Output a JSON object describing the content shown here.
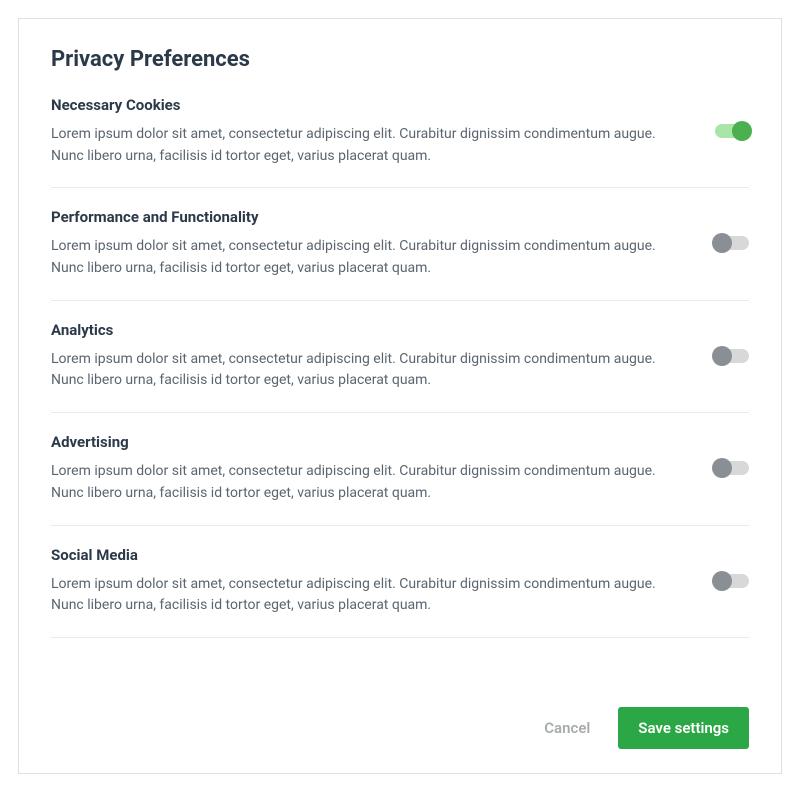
{
  "title": "Privacy Preferences",
  "categories": [
    {
      "title": "Necessary Cookies",
      "desc": "Lorem ipsum dolor sit amet, consectetur adipiscing elit. Curabitur dignissim condimentum augue. Nunc libero urna, facilisis id tortor eget, varius placerat quam.",
      "on": true
    },
    {
      "title": "Performance and Functionality",
      "desc": "Lorem ipsum dolor sit amet, consectetur adipiscing elit. Curabitur dignissim condimentum augue. Nunc libero urna, facilisis id tortor eget, varius placerat quam.",
      "on": false
    },
    {
      "title": "Analytics",
      "desc": "Lorem ipsum dolor sit amet, consectetur adipiscing elit. Curabitur dignissim condimentum augue. Nunc libero urna, facilisis id tortor eget, varius placerat quam.",
      "on": false
    },
    {
      "title": "Advertising",
      "desc": "Lorem ipsum dolor sit amet, consectetur adipiscing elit. Curabitur dignissim condimentum augue. Nunc libero urna, facilisis id tortor eget, varius placerat quam.",
      "on": false
    },
    {
      "title": "Social Media",
      "desc": "Lorem ipsum dolor sit amet, consectetur adipiscing elit. Curabitur dignissim condimentum augue. Nunc libero urna, facilisis id tortor eget, varius placerat quam.",
      "on": false
    }
  ],
  "actions": {
    "cancel": "Cancel",
    "save": "Save settings"
  }
}
